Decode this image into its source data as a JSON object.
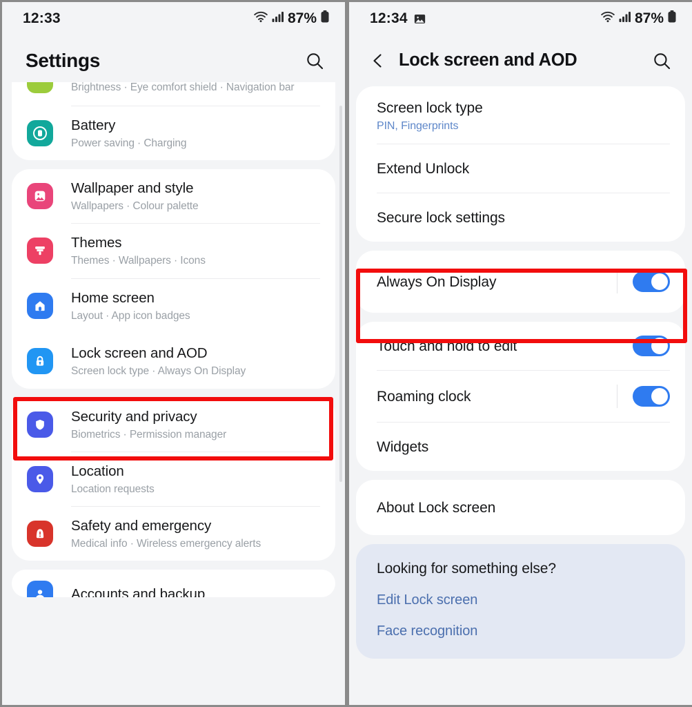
{
  "left": {
    "status": {
      "time": "12:33",
      "battery_pct": "87%",
      "wifi_icon": "wifi-icon",
      "signal_icon": "signal-bars-icon",
      "battery_icon": "battery-icon"
    },
    "header": {
      "title": "Settings",
      "search_icon": "search-icon"
    },
    "groups": [
      {
        "id": "display-battery",
        "items": [
          {
            "label": "",
            "sub": "Brightness  ·  Eye comfort shield  ·  Navigation bar",
            "icon": "display-icon",
            "icon_color": "#9ccc3c",
            "partial": true
          },
          {
            "label": "Battery",
            "sub": "Power saving  ·  Charging",
            "icon": "battery-settings-icon",
            "icon_color": "#12a89b"
          }
        ]
      },
      {
        "id": "personalization",
        "items": [
          {
            "label": "Wallpaper and style",
            "sub": "Wallpapers  ·  Colour palette",
            "icon": "wallpaper-icon",
            "icon_color": "#e9457a"
          },
          {
            "label": "Themes",
            "sub": "Themes  ·  Wallpapers  ·  Icons",
            "icon": "themes-brush-icon",
            "icon_color": "#ed4064"
          },
          {
            "label": "Home screen",
            "sub": "Layout  ·  App icon badges",
            "icon": "home-icon",
            "icon_color": "#2f7bf0"
          },
          {
            "label": "Lock screen and AOD",
            "sub": "Screen lock type  ·  Always On Display",
            "icon": "lock-icon",
            "icon_color": "#2196f3",
            "highlighted": true
          }
        ]
      },
      {
        "id": "security",
        "items": [
          {
            "label": "Security and privacy",
            "sub": "Biometrics  ·  Permission manager",
            "icon": "shield-icon",
            "icon_color": "#4a5ae8"
          },
          {
            "label": "Location",
            "sub": "Location requests",
            "icon": "location-pin-icon",
            "icon_color": "#4a5ae8"
          },
          {
            "label": "Safety and emergency",
            "sub": "Medical info  ·  Wireless emergency alerts",
            "icon": "emergency-icon",
            "icon_color": "#d8342b"
          }
        ]
      },
      {
        "id": "accounts",
        "items": [
          {
            "label": "Accounts and backup",
            "sub": "",
            "icon": "accounts-icon",
            "icon_color": "#2f7bf0",
            "partial_bottom": true
          }
        ]
      }
    ]
  },
  "right": {
    "status": {
      "time": "12:34",
      "screenshot_icon": "screenshot-image-icon",
      "battery_pct": "87%",
      "wifi_icon": "wifi-icon",
      "signal_icon": "signal-bars-icon",
      "battery_icon": "battery-icon"
    },
    "header": {
      "title": "Lock screen and AOD",
      "back_icon": "back-chevron-icon",
      "search_icon": "search-icon"
    },
    "groups": [
      {
        "id": "lock-basics",
        "rows": [
          {
            "label": "Screen lock type",
            "sub": "PIN, Fingerprints",
            "divider": true
          },
          {
            "label": "Extend Unlock",
            "divider": true
          },
          {
            "label": "Secure lock settings",
            "divider": false
          }
        ]
      },
      {
        "id": "aod",
        "highlighted": true,
        "rows": [
          {
            "label": "Always On Display",
            "toggle": true,
            "toggle_on": true,
            "separator": true,
            "divider": false
          }
        ]
      },
      {
        "id": "lock-options",
        "rows": [
          {
            "label": "Touch and hold to edit",
            "toggle": true,
            "toggle_on": true,
            "separator": false,
            "divider": true
          },
          {
            "label": "Roaming clock",
            "toggle": true,
            "toggle_on": true,
            "separator": true,
            "divider": true
          },
          {
            "label": "Widgets",
            "divider": false
          }
        ]
      },
      {
        "id": "about",
        "rows": [
          {
            "label": "About Lock screen",
            "divider": false
          }
        ]
      }
    ],
    "suggestion": {
      "title": "Looking for something else?",
      "links": [
        "Edit Lock screen",
        "Face recognition"
      ]
    }
  },
  "colors": {
    "highlight": "#f20d0d",
    "toggle_on": "#2f7bf0",
    "link": "#4b6fae",
    "sub_link": "#5e87c9",
    "panel_bg": "#f3f4f6",
    "card_bg": "#ffffff",
    "suggest_bg": "#e3e8f3"
  }
}
